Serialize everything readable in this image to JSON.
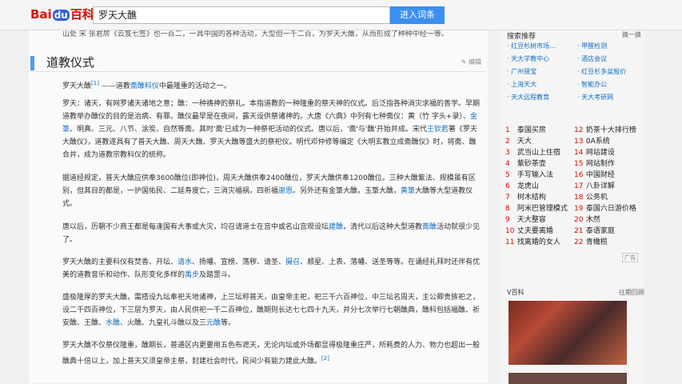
{
  "header": {
    "logo_bai": "Bai",
    "logo_du": "du",
    "logo_baike": "百科",
    "search_value": "罗天大醮",
    "search_button": "进入词条"
  },
  "article": {
    "cut_line": "山处 宋 张君房《云笈七签》也一百二，一具中国的各种活动，大型但一千二百，为罗天大醮，从而形成了种种中经一等。",
    "section_title": "道教仪式",
    "edit": "编辑",
    "p1_a": "罗天大醮",
    "p1_sup": "[1]",
    "p1_b": "——道教",
    "p1_link": "斋醮科仪",
    "p1_c": "中最隆重的活动之一。",
    "p2_a": "罗天：诸天，有网罗诸天诸地之意；醮：一种祷神的祭礼。本指道教的一种隆重的祭天神的仪式。后泛指各种消灾求福的善学。早期道教举办醮仪的目的是治病、有罪。醮仪最早是在夜间，露天设供祭诸神的。大唐《六典》中列有七种斋仪：黄（竹 字头+录）、",
    "p2_link1": "金箓",
    "p2_b": "、明真、三元、八节、涂炭、自然等斋。其时'斋'已成为一种祭祀活动的仪式。唐以后，'斋'与'醮'开始并成。宋代",
    "p2_link2": "王钦若",
    "p2_c": "著《罗天大醮仪》，道教遂具有了普天大醮、周天大醮、罗天大醮等盛大的祭祀仪。明代邓仲修等编定《大明玄教立成斋醮仪》时，将斋、醮合并，成为道教宗教科仪的统称。",
    "p3_a": "据道经规定，普天大醮应供奉3600醮位(即神位)，周天大醮供奉2400醮位，罗天大醮供奉1200醮位。三种大醮紫法、规模虽有区别，但其目的都是，一护国佑民、二延寿度亡，三消灾福祸，四祈福",
    "p3_link1": "谢恩",
    "p3_b": "。另外还有金箓大醮，玉箓大醮，",
    "p3_link2": "黄箓",
    "p3_c": "大醮等大型道教仪式。",
    "p4_a": "唐以后，历朝不少商王都是每逢国有大事或大灾，均召请道士在宫中或名山宫观设坛",
    "p4_link1": "建醮",
    "p4_b": "，清代以后这种大型道教",
    "p4_link2": "斋醮",
    "p4_c": "活动就很少见了。",
    "p5_a": "罗天大醮的主要科仪有焚香、开坛、",
    "p5_link1": "请水",
    "p5_b": "、扬幡、宣榜、荡秽、请圣、",
    "p5_link2": "摄召",
    "p5_c": "、顺星、上表、落幡、送圣等等。在诵经礼拜时还伴有优美的道教音乐和动作、队形变化多样的",
    "p5_link3": "禹步",
    "p5_d": "及踏罡斗。",
    "p6_a": "盛极隆厚的罗天大醮，需搭设九坛奉祀天地诸神，上三坛称普天，由皇帝主祀，祀三千六百神位，中三坛名周天，主公卿贵族祀之，设二千四百神位，下三层为罗天，由人民供祀一千二百神位，醮期则长达七七四十九天，并分七次举行七朝醮典，醮科包括福醮、祈安醮、王醮、",
    "p6_link1": "水醮",
    "p6_b": "、火醮、九皇礼斗醮以及三",
    "p6_link2": "元醮",
    "p6_c": "等。",
    "p7_a": "罗天大醮不仅祭仪隆重，醮期长，普通区内更要用五色布遮天，无论内坛或外场都显得极隆重庄严，所耗费的人力、物力也超出一般醮典十倍以上，加上普天又须皇帝主祭，封建社会时代，民间少有能力建此大醮。",
    "p7_sup": "[2]"
  },
  "sidebar": {
    "head": "搜索推荐",
    "head_right": "换一换",
    "links": [
      [
        "红豆杉树市场...",
        "甲醛检测"
      ],
      [
        "天大学教中心",
        "酒店会议"
      ],
      [
        "广州驿宝",
        "红豆杉多盆报价"
      ],
      [
        "上海天大",
        "智能办公"
      ],
      [
        "天大远程教育",
        "天大考研网"
      ]
    ],
    "rank": [
      [
        "1",
        "泰国买房",
        "12",
        "奶茶十大排行榜"
      ],
      [
        "2",
        "天大",
        "13",
        "0A系统"
      ],
      [
        "3",
        "武当山上住宿",
        "14",
        "网站建设"
      ],
      [
        "4",
        "紫砂茶壶",
        "15",
        "网站制作"
      ],
      [
        "5",
        "手写输入法",
        "16",
        "中国财经"
      ],
      [
        "6",
        "龙虎山",
        "17",
        "八卦详解"
      ],
      [
        "7",
        "树木结构",
        "18",
        "公务机"
      ],
      [
        "8",
        "阿米巴管理模式",
        "19",
        "泰国六日游价格"
      ],
      [
        "9",
        "天大整容",
        "20",
        "木然"
      ],
      [
        "10",
        "丈夫要离婚",
        "21",
        "泰语家庭"
      ],
      [
        "11",
        "找离婚的女人",
        "22",
        "青橄榄"
      ]
    ],
    "ad": "广告",
    "video_head": "V百科",
    "video_right": "往期回顾"
  }
}
